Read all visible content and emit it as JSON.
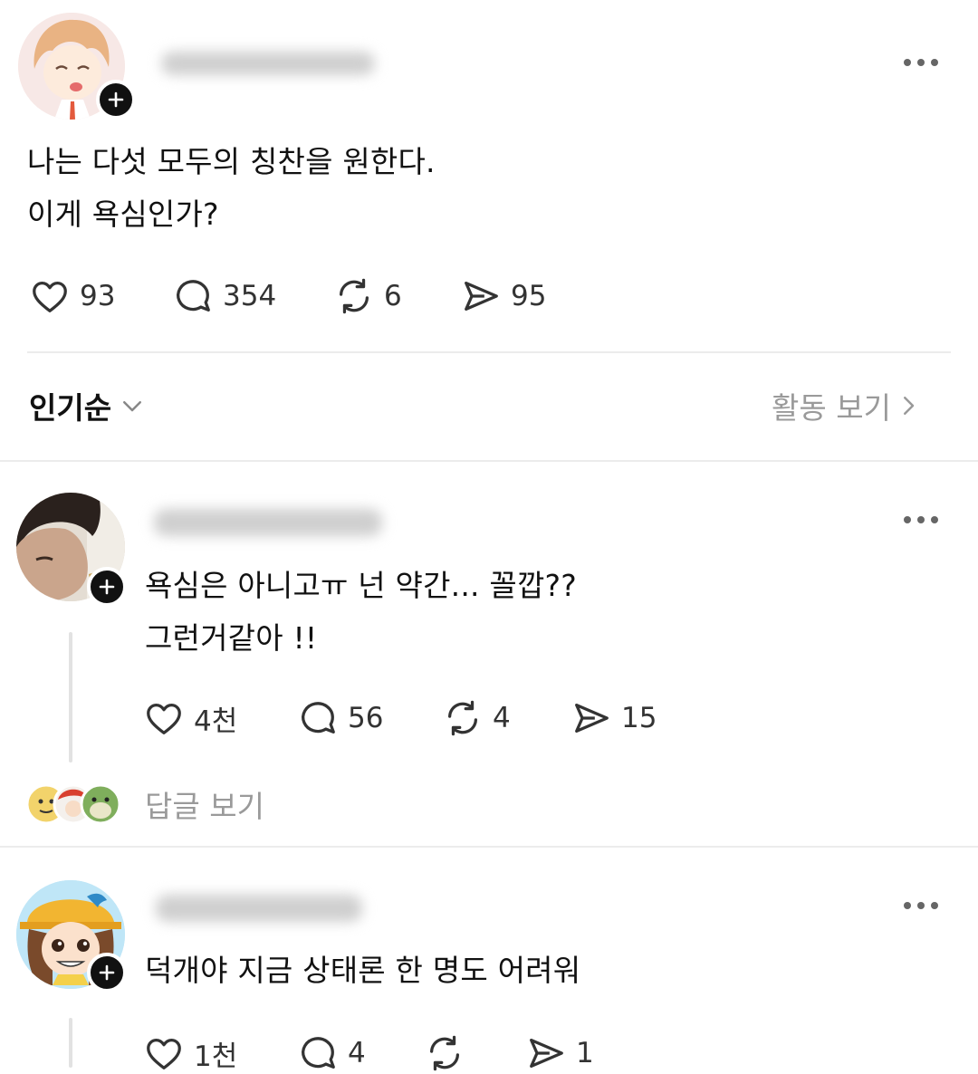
{
  "post": {
    "text_line1": "나는 다섯 모두의 칭찬을 원한다.",
    "text_line2": "이게 욕심인가?",
    "likes": "93",
    "comments": "354",
    "reposts": "6",
    "shares": "95"
  },
  "sort": {
    "label": "인기순",
    "activity_link": "활동 보기"
  },
  "replies": [
    {
      "text_line1": "욕심은 아니고ㅠ 넌 약간... 꼴깝??",
      "text_line2": "그런거같아 !!",
      "likes": "4천",
      "comments": "56",
      "reposts": "4",
      "shares": "15",
      "view_replies": "답글 보기"
    },
    {
      "text_line1": "덕개야 지금 상태론 한 명도 어려워",
      "likes": "1천",
      "comments": "4",
      "reposts": "",
      "shares": "1"
    }
  ],
  "colors": {
    "text": "#111111",
    "secondary": "#9a9a9a",
    "divider": "#ececec",
    "icon": "#333333"
  }
}
